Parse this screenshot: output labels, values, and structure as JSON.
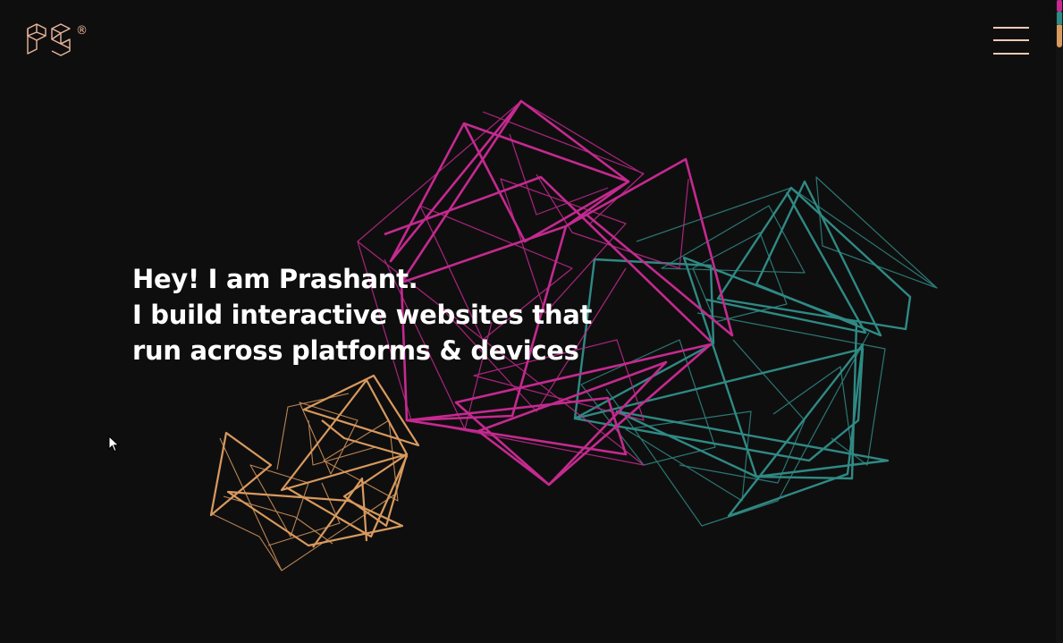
{
  "logo": {
    "text": "PS",
    "mark": "®",
    "color": "#e9b79a"
  },
  "menu": {
    "icon": "hamburger-menu-icon",
    "color": "#f2c9b3"
  },
  "hero": {
    "line1": "Hey! I am Prashant.",
    "line2": "I build interactive websites that",
    "line3": "run across platforms & devices"
  },
  "colors": {
    "background": "#0f0e0f",
    "magenta": "#c42a8f",
    "teal": "#2f8a84",
    "orange": "#d89a5e"
  },
  "scroll_indicator": {
    "segments": [
      "#c42a8f",
      "#2f8a84",
      "#d89a5e"
    ]
  }
}
